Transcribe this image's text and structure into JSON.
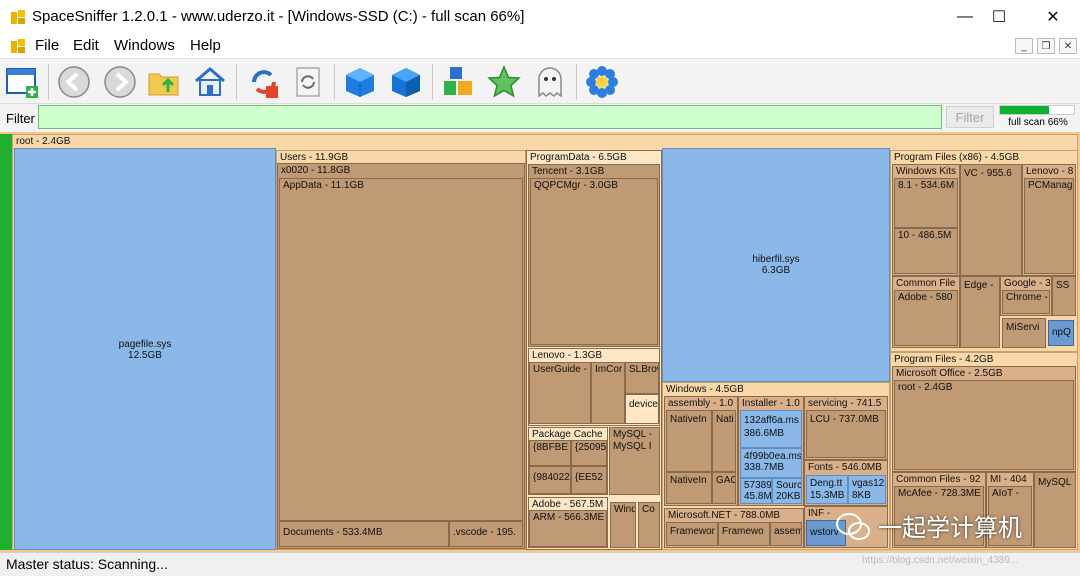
{
  "window": {
    "title": "SpaceSniffer 1.2.0.1 - www.uderzo.it - [Windows-SSD (C:) - full scan 66%]",
    "minimize": "—",
    "maximize": "☐",
    "close": "✕"
  },
  "menu": {
    "items": [
      "File",
      "Edit",
      "Windows",
      "Help"
    ],
    "mdi_minimize": "_",
    "mdi_restore": "❐",
    "mdi_close": "✕"
  },
  "toolbar": {
    "icons": [
      "new-window-icon",
      "back-icon",
      "forward-icon",
      "folder-up-icon",
      "home-icon",
      "refresh-icon",
      "rescan-icon",
      "cube-icon",
      "cube-filled-icon",
      "blocks-icon",
      "star-icon",
      "ghost-icon",
      "settings-flower-icon"
    ]
  },
  "filter": {
    "label": "Filter",
    "value": "",
    "button": "Filter",
    "progress_percent": 66,
    "progress_text": "full scan 66%"
  },
  "treemap": {
    "root": "root - 2.4GB",
    "pagefile": {
      "name": "pagefile.sys",
      "size": "12.5GB"
    },
    "users": "Users - 11.9GB",
    "x0020": "x0020 - 11.8GB",
    "appdata": "AppData - 11.1GB",
    "documents": "Documents - 533.4MB",
    "vscode": ".vscode - 195.",
    "programdata": "ProgramData - 6.5GB",
    "tencent": "Tencent - 3.1GB",
    "qqpcmgr": "QQPCMgr - 3.0GB",
    "lenovo_pd": "Lenovo - 1.3GB",
    "userguide": "UserGuide -",
    "imcor": "ImCor",
    "slbrow": "SLBrow",
    "device": "device",
    "package_cache": "Package Cache",
    "pc1": "{8BFBE",
    "pc2": "{25095",
    "pc3": "{984022",
    "pc4": "{EE52",
    "mysql_pd": "MySQL -",
    "mysql_pd2": "MySQL I",
    "adobe_pd": "Adobe - 567.5M",
    "arm": "ARM - 566.3ME",
    "wind": "Wind",
    "co": "Co",
    "hiberfil": {
      "name": "hiberfil.sys",
      "size": "6.3GB"
    },
    "windows": "Windows - 4.5GB",
    "assembly": "assembly - 1.0",
    "nativei1": "NativeIn",
    "nati": "Nati",
    "nativei2": "NativeIn",
    "gac": "GAC",
    "installer": "Installer - 1.0",
    "msi1": {
      "name": "132aff6a.ms",
      "size": "386.6MB"
    },
    "msi2": {
      "name": "4f99b0ea.ms",
      "size": "338.7MB"
    },
    "msi3": {
      "name": "57389",
      "size": "45.8M"
    },
    "msi4": {
      "name": "Sourc",
      "size": "20KB"
    },
    "servicing": "servicing - 741.5",
    "lcu": "LCU - 737.0MB",
    "fonts": "Fonts - 546.0MB",
    "deng": {
      "name": "Deng.tt",
      "size": "15.3MB"
    },
    "vgas": {
      "name": "vgas12",
      "size": "8KB"
    },
    "inf": "INF -",
    "wstory": "wstorv",
    "msnet": "Microsoft.NET - 788.0MB",
    "fw1": "Framewor",
    "fw2": "Framewo",
    "assem": "assem",
    "pf86": "Program Files (x86) - 4.5GB",
    "winkits": "Windows Kits",
    "k81": "8.1 - 534.6M",
    "k10": "10 - 486.5M",
    "vc": "VC - 955.6",
    "lenovo_86": "Lenovo - 8",
    "pcmanag": "PCManag",
    "common86": "Common File",
    "adobe86": "Adobe - 580",
    "edge": "Edge -",
    "google": "Google - 3",
    "chrome": "Chrome -",
    "ss": "SS",
    "miservi": "MiServi",
    "npq": "npQ",
    "pf": "Program Files - 4.2GB",
    "msoffice": "Microsoft Office - 2.5GB",
    "commonpf": "Common Files - 92",
    "mcafee": "McAfee - 728.3ME",
    "mi": "MI - 404",
    "aiot": "AIoT -",
    "mysqlpf": "MySQL"
  },
  "status": {
    "text": "Master status: Scanning..."
  },
  "watermark": {
    "text": "一起学计算机",
    "url": "https://blog.csdn.net/weixin_4389..."
  },
  "colors": {
    "folder": "#c09a74",
    "file": "#8ab8e8",
    "header": "#f8d8a8",
    "filter_bg": "#ccffcc",
    "progress": "#12b030"
  }
}
